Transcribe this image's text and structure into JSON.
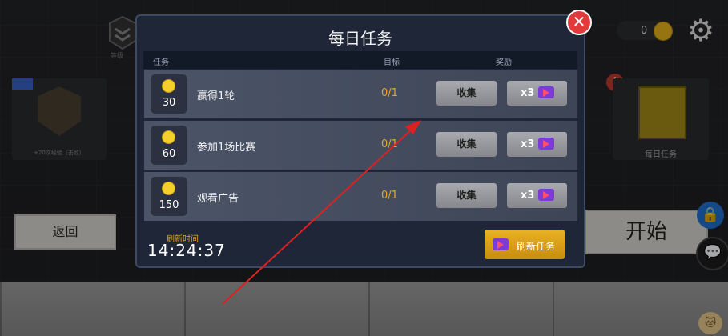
{
  "background": {
    "rank_label": "等级",
    "left_card_text": "+20次经验（击败）",
    "back_button": "返回",
    "coin_count": "0",
    "daily_tasks_label": "每日任务",
    "start_button": "开始"
  },
  "modal": {
    "title": "每日任务",
    "close_symbol": "✕",
    "headers": {
      "task": "任务",
      "goal": "目标",
      "reward": "奖励"
    },
    "tasks": [
      {
        "reward": "30",
        "name": "赢得1轮",
        "progress": "0/1",
        "collect": "收集",
        "multiplier": "x3"
      },
      {
        "reward": "60",
        "name": "参加1场比赛",
        "progress": "0/1",
        "collect": "收集",
        "multiplier": "x3"
      },
      {
        "reward": "150",
        "name": "观看广告",
        "progress": "0/1",
        "collect": "收集",
        "multiplier": "x3"
      }
    ],
    "refresh_label": "刷新时间",
    "refresh_time": "14:24:37",
    "refresh_button": "刷新任务"
  },
  "colors": {
    "modal_bg": "#1e2637",
    "close": "#e23a3a",
    "progress_text": "#e2a72a",
    "refresh_button": "#e2a72a",
    "annotation_arrow": "#e02020"
  },
  "icons": [
    "rank-emblem-icon",
    "coin-icon",
    "gear-icon",
    "alert-icon",
    "video-ad-icon",
    "lock-icon",
    "chat-icon"
  ]
}
